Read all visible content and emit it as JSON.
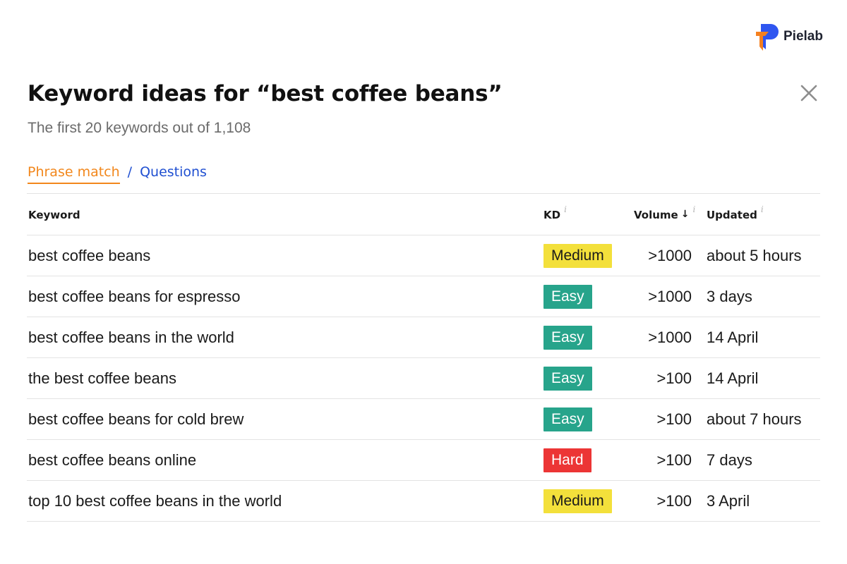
{
  "brand": {
    "name": "Pielab"
  },
  "header": {
    "title": "Keyword ideas for “best coffee beans”",
    "subtitle": "The first 20 keywords out of 1,108"
  },
  "tabs": [
    {
      "label": "Phrase match",
      "active": true
    },
    {
      "label": "Questions",
      "active": false
    }
  ],
  "tab_separator": "/",
  "table": {
    "columns": {
      "keyword": "Keyword",
      "kd": "KD",
      "volume": "Volume",
      "updated": "Updated",
      "info_glyph": "i",
      "sort_arrow": "↓"
    },
    "rows": [
      {
        "keyword": "best coffee beans",
        "kd": "Medium",
        "volume": ">1000",
        "updated": "about 5 hours"
      },
      {
        "keyword": "best coffee beans for espresso",
        "kd": "Easy",
        "volume": ">1000",
        "updated": "3 days"
      },
      {
        "keyword": "best coffee beans in the world",
        "kd": "Easy",
        "volume": ">1000",
        "updated": "14 April"
      },
      {
        "keyword": "the best coffee beans",
        "kd": "Easy",
        "volume": ">100",
        "updated": "14 April"
      },
      {
        "keyword": "best coffee beans for cold brew",
        "kd": "Easy",
        "volume": ">100",
        "updated": "about 7 hours"
      },
      {
        "keyword": "best coffee beans online",
        "kd": "Hard",
        "volume": ">100",
        "updated": "7 days"
      },
      {
        "keyword": "top 10 best coffee beans in the world",
        "kd": "Medium",
        "volume": ">100",
        "updated": "3 April"
      }
    ]
  },
  "colors": {
    "accent_tab": "#f2871c",
    "link": "#1f4fd1",
    "kd_medium": "#f3e03b",
    "kd_easy": "#27a48b",
    "kd_hard": "#ec3535"
  },
  "icons": {
    "close": "close-icon",
    "logo": "pielab-logo-icon"
  }
}
